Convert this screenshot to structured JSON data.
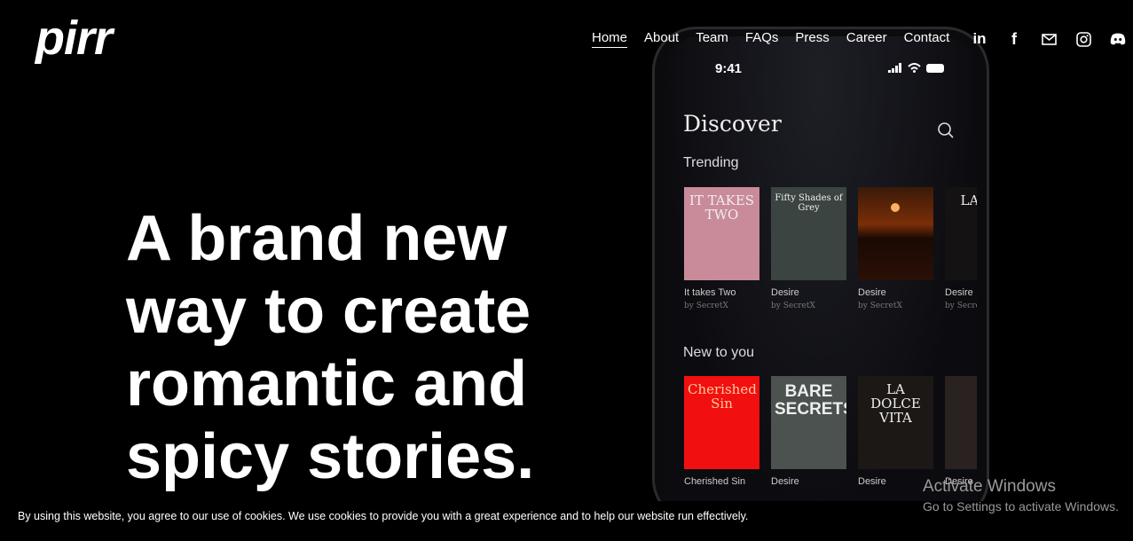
{
  "logo": "pirr",
  "nav": {
    "items": [
      "Home",
      "About",
      "Team",
      "FAQs",
      "Press",
      "Career",
      "Contact"
    ],
    "active": "Home"
  },
  "social": [
    "linkedin-icon",
    "facebook-icon",
    "mail-icon",
    "instagram-icon",
    "discord-icon"
  ],
  "hero": {
    "line1": "A brand new",
    "line2": "way to create",
    "line3": "romantic and",
    "line4": "spicy stories."
  },
  "phone": {
    "time": "9:41",
    "title": "Discover",
    "trending_label": "Trending",
    "new_label": "New to you",
    "trending": [
      {
        "cover": "IT TAKES TWO",
        "title": "It takes Two",
        "author": "by SecretX",
        "bg": "#c98a99"
      },
      {
        "cover": "Fifty Shades of Grey",
        "title": "Desire",
        "author": "by SecretX",
        "bg": "#3b4440"
      },
      {
        "cover": "",
        "title": "Desire",
        "author": "by SecretX",
        "bg": "#2a1508"
      },
      {
        "cover": "LA DO",
        "title": "Desire",
        "author": "by Secre",
        "bg": "#141212"
      }
    ],
    "new": [
      {
        "cover": "Cherished Sin",
        "title": "Cherished Sin",
        "bg": "#f20f0f"
      },
      {
        "cover": "BARE SECRETS",
        "title": "Desire",
        "bg": "#4b5250"
      },
      {
        "cover": "LA DOLCE VITA",
        "title": "Desire",
        "bg": "#1c1816"
      },
      {
        "cover": "",
        "title": "Desire",
        "bg": "#2a2220"
      }
    ]
  },
  "cookie": "By using this website, you agree to our use of cookies. We use cookies to provide you with a great experience and to help our website run effectively.",
  "watermark": {
    "title": "Activate Windows",
    "subtitle": "Go to Settings to activate Windows."
  }
}
